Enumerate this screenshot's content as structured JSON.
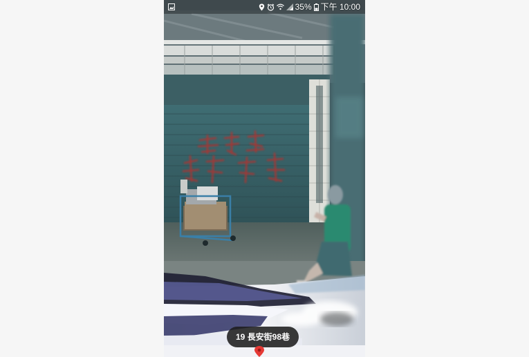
{
  "status_bar": {
    "time": "下午 10:00",
    "battery": "35%",
    "icons": [
      "gallery-notification-icon",
      "location-icon",
      "alarm-icon",
      "wifi-icon",
      "signal-icon",
      "battery-icon"
    ]
  },
  "street_view": {
    "address": "19 長安街98巷"
  },
  "colors": {
    "chip_background": "#1e1e1e",
    "pin": "#e53935",
    "status_text": "#ffffff"
  }
}
